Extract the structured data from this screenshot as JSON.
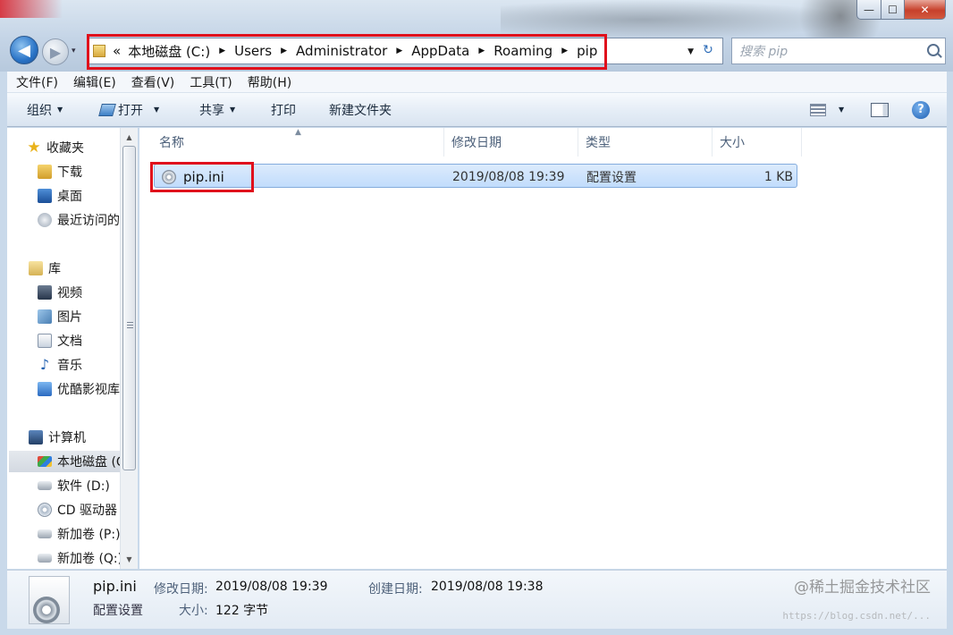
{
  "window": {
    "min_glyph": "—",
    "max_glyph": "☐",
    "close_glyph": "✕"
  },
  "nav": {
    "back_glyph": "◀",
    "forward_glyph": "▶",
    "recent_glyph": "▾"
  },
  "address": {
    "overflow": "«",
    "breadcrumbs": [
      "本地磁盘 (C:)",
      "Users",
      "Administrator",
      "AppData",
      "Roaming",
      "pip"
    ],
    "sep_glyph": "▶",
    "dropdown_glyph": "▼",
    "refresh_glyph": "↻"
  },
  "search": {
    "placeholder": "搜索 pip"
  },
  "menu": {
    "items": [
      "文件(F)",
      "编辑(E)",
      "查看(V)",
      "工具(T)",
      "帮助(H)"
    ]
  },
  "toolbar": {
    "organize": "组织",
    "open": "打开",
    "share": "共享",
    "print": "打印",
    "new_folder": "新建文件夹",
    "caret": "▼",
    "help_glyph": "?"
  },
  "sidebar": {
    "items": [
      {
        "label": "收藏夹",
        "icon": "star-icon"
      },
      {
        "label": "下载",
        "icon": "downloads-folder-icon"
      },
      {
        "label": "桌面",
        "icon": "desktop-icon"
      },
      {
        "label": "最近访问的",
        "icon": "recent-places-icon"
      },
      {
        "label": "库",
        "icon": "library-icon"
      },
      {
        "label": "视频",
        "icon": "video-library-icon"
      },
      {
        "label": "图片",
        "icon": "pictures-library-icon"
      },
      {
        "label": "文档",
        "icon": "documents-library-icon"
      },
      {
        "label": "音乐",
        "icon": "music-library-icon"
      },
      {
        "label": "优酷影视库",
        "icon": "youku-library-icon"
      },
      {
        "label": "计算机",
        "icon": "computer-icon"
      },
      {
        "label": "本地磁盘 (C:)",
        "icon": "system-drive-icon",
        "selected": true
      },
      {
        "label": "软件 (D:)",
        "icon": "drive-icon"
      },
      {
        "label": "CD 驱动器",
        "icon": "cd-drive-icon"
      },
      {
        "label": "新加卷 (P:)",
        "icon": "drive-icon"
      },
      {
        "label": "新加卷 (Q:)",
        "icon": "drive-icon"
      }
    ],
    "scroll_up": "▲",
    "scroll_down": "▼"
  },
  "columns": {
    "name": "名称",
    "modified": "修改日期",
    "type": "类型",
    "size": "大小",
    "sort_glyph": "▲"
  },
  "files": [
    {
      "name": "pip.ini",
      "modified": "2019/08/08 19:39",
      "type": "配置设置",
      "size": "1 KB"
    }
  ],
  "details": {
    "name": "pip.ini",
    "type": "配置设置",
    "modified_label": "修改日期:",
    "modified_value": "2019/08/08 19:39",
    "created_label": "创建日期:",
    "created_value": "2019/08/08 19:38",
    "size_label": "大小:",
    "size_value": "122 字节"
  },
  "watermark": {
    "text": "@稀土掘金技术社区",
    "url": "https://blog.csdn.net/..."
  },
  "colors": {
    "highlight_red": "#e0101c",
    "selection_blue": "#c1dcfc"
  }
}
